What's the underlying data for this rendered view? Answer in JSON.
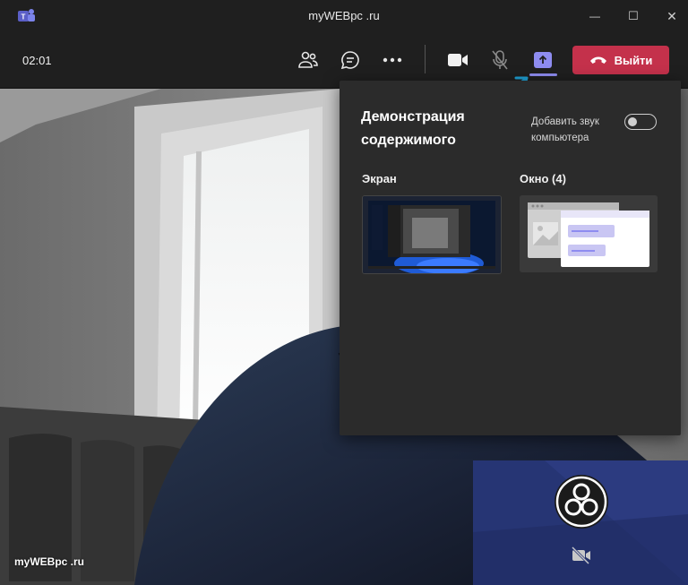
{
  "window": {
    "title": "myWEBpc .ru",
    "minimize_glyph": "—",
    "maximize_glyph": "☐",
    "close_glyph": "✕"
  },
  "toolbar": {
    "timer": "02:01",
    "leave_label": "Выйти",
    "icons": [
      "people-icon",
      "chat-icon",
      "more-icon",
      "camera-icon",
      "mic-off-icon",
      "share-tray-icon",
      "phone-hangup-icon"
    ],
    "colors": {
      "leave": "#c4314b",
      "share_accent": "#8e8cf0",
      "annotation_arrow": "#1ea0d4"
    }
  },
  "share_panel": {
    "title": "Демонстрация содержимого",
    "audio_label": "Добавить звук компьютера",
    "audio_toggle": "off",
    "screen_label": "Экран",
    "window_label": "Окно (4)"
  },
  "video": {
    "overlay_text": "myWEBpc .ru",
    "selfview_icons": [
      "obs-logo-icon",
      "camera-off-icon"
    ]
  }
}
